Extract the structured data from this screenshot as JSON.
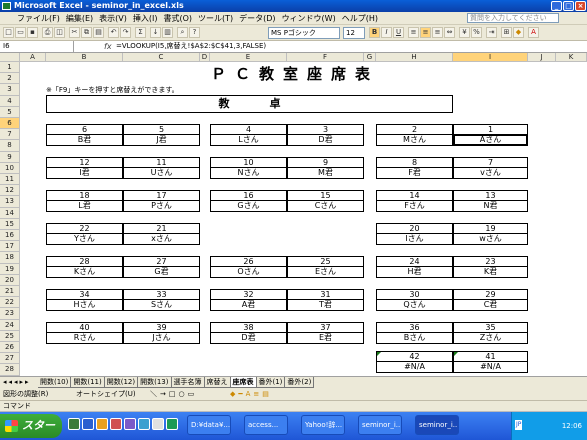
{
  "window": {
    "title": "Microsoft Excel - seminor_in_excel.xls"
  },
  "menu": [
    "ファイル(F)",
    "編集(E)",
    "表示(V)",
    "挿入(I)",
    "書式(O)",
    "ツール(T)",
    "データ(D)",
    "ウィンドウ(W)",
    "ヘルプ(H)"
  ],
  "help_placeholder": "質問を入力してください",
  "toolbar": {
    "font": "MS Pゴシック",
    "size": "12",
    "bold": "B",
    "italic": "I",
    "underline": "U"
  },
  "formula_bar": {
    "cell": "I6",
    "fx": "fx",
    "formula": "=VLOOKUP(I5,席替え!$A$2:$C$41,3,FALSE)"
  },
  "columns": [
    "A",
    "B",
    "C",
    "D",
    "E",
    "F",
    "G",
    "H",
    "I",
    "J",
    "K"
  ],
  "rows": [
    "1",
    "2",
    "3",
    "4",
    "5",
    "6",
    "7",
    "8",
    "9",
    "10",
    "11",
    "12",
    "13",
    "14",
    "15",
    "16",
    "17",
    "18",
    "19",
    "20",
    "21",
    "22",
    "23",
    "24",
    "25",
    "26",
    "27",
    "28"
  ],
  "sheet": {
    "title": "ＰＣ教室座席表",
    "note": "※「F9」キーを押すと席替えができます。",
    "desk": "教卓",
    "seats": [
      {
        "num": "6",
        "name": "B君"
      },
      {
        "num": "5",
        "name": "J君"
      },
      {
        "num": "4",
        "name": "Lさん"
      },
      {
        "num": "3",
        "name": "D君"
      },
      {
        "num": "2",
        "name": "Mさん"
      },
      {
        "num": "1",
        "name": "Aさん"
      },
      {
        "num": "12",
        "name": "I君"
      },
      {
        "num": "11",
        "name": "Uさん"
      },
      {
        "num": "10",
        "name": "Nさん"
      },
      {
        "num": "9",
        "name": "M君"
      },
      {
        "num": "8",
        "name": "F君"
      },
      {
        "num": "7",
        "name": "vさん"
      },
      {
        "num": "18",
        "name": "L君"
      },
      {
        "num": "17",
        "name": "Pさん"
      },
      {
        "num": "16",
        "name": "Gさん"
      },
      {
        "num": "15",
        "name": "Cさん"
      },
      {
        "num": "14",
        "name": "Fさん"
      },
      {
        "num": "13",
        "name": "N君"
      },
      {
        "num": "22",
        "name": "Yさん"
      },
      {
        "num": "21",
        "name": "xさん"
      },
      {
        "num": "20",
        "name": "Iさん"
      },
      {
        "num": "19",
        "name": "wさん"
      },
      {
        "num": "28",
        "name": "Kさん"
      },
      {
        "num": "27",
        "name": "G君"
      },
      {
        "num": "26",
        "name": "Oさん"
      },
      {
        "num": "25",
        "name": "Eさん"
      },
      {
        "num": "24",
        "name": "H君"
      },
      {
        "num": "23",
        "name": "K君"
      },
      {
        "num": "34",
        "name": "Hさん"
      },
      {
        "num": "33",
        "name": "Sさん"
      },
      {
        "num": "32",
        "name": "A君"
      },
      {
        "num": "31",
        "name": "T君"
      },
      {
        "num": "30",
        "name": "Qさん"
      },
      {
        "num": "29",
        "name": "C君"
      },
      {
        "num": "40",
        "name": "Rさん"
      },
      {
        "num": "39",
        "name": "Jさん"
      },
      {
        "num": "38",
        "name": "D君"
      },
      {
        "num": "37",
        "name": "E君"
      },
      {
        "num": "36",
        "name": "Bさん"
      },
      {
        "num": "35",
        "name": "Zさん"
      },
      {
        "num": "42",
        "name": "#N/A"
      },
      {
        "num": "41",
        "name": "#N/A"
      }
    ]
  },
  "tabs": [
    "開数(10)",
    "開数(11)",
    "開数(12)",
    "開数(13)",
    "選手名簿",
    "席替え",
    "座席表",
    "番外(1)",
    "番外(2)"
  ],
  "drawbar": {
    "label": "図形の調整(R)",
    "autoshape": "オートシェイプ(U)"
  },
  "status": "コマンド",
  "taskbar": {
    "start": "スタート",
    "tasks": [
      "D:¥data¥...",
      "access...",
      "Yahoo!辞...",
      "seminor_i...",
      "seminor_i..."
    ],
    "ime": "JP",
    "clock": "12:06"
  }
}
